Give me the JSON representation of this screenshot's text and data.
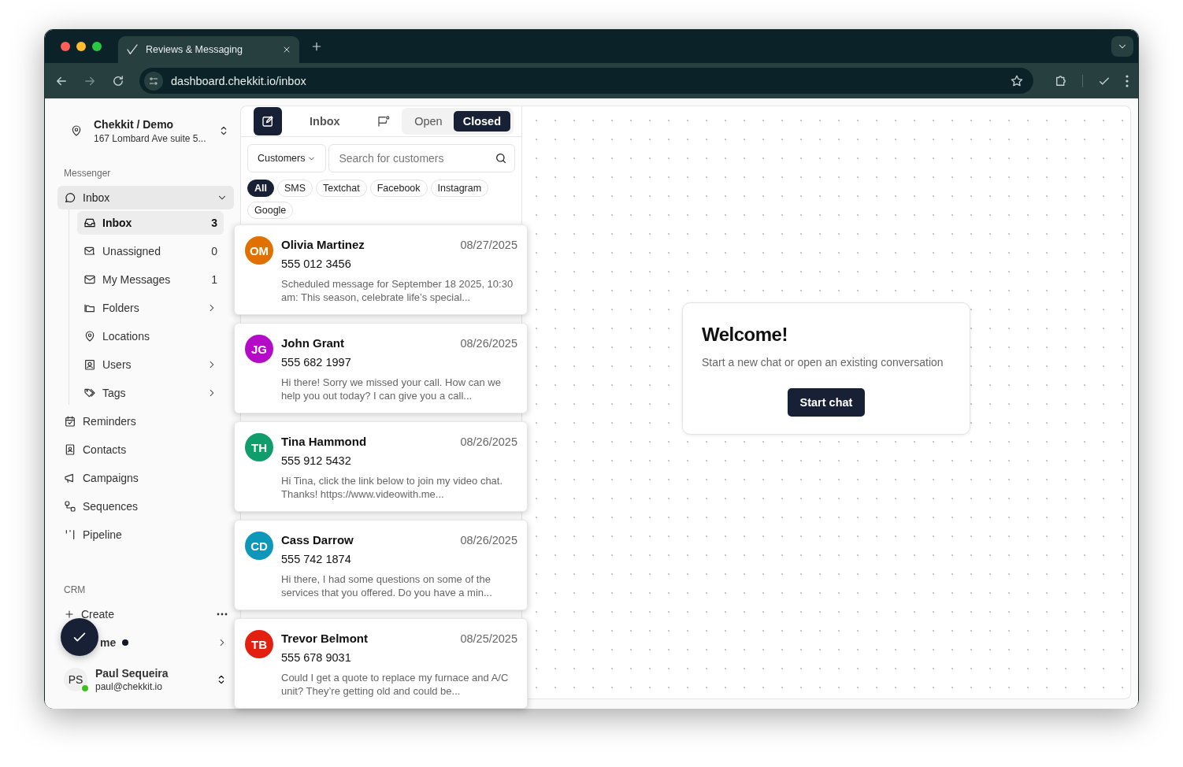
{
  "browser": {
    "tab_title": "Reviews & Messaging",
    "url": "dashboard.chekkit.io/inbox"
  },
  "account": {
    "name": "Chekkit / Demo",
    "address": "167 Lombard Ave suite 5..."
  },
  "sidebar": {
    "messenger_heading": "Messenger",
    "group": {
      "label": "Inbox",
      "selected": true,
      "expanded": true,
      "children": [
        {
          "label": "Inbox",
          "kind": "count",
          "count": "3",
          "selected": true
        },
        {
          "label": "Unassigned",
          "kind": "count",
          "count": "0",
          "selected": false
        },
        {
          "label": "My Messages",
          "kind": "count",
          "count": "1",
          "selected": false
        },
        {
          "label": "Folders",
          "kind": "submenu",
          "selected": false
        },
        {
          "label": "Locations",
          "kind": "plain",
          "selected": false
        },
        {
          "label": "Users",
          "kind": "submenu",
          "selected": false
        },
        {
          "label": "Tags",
          "kind": "submenu",
          "selected": false
        }
      ]
    },
    "items": [
      {
        "label": "Reminders"
      },
      {
        "label": "Contacts"
      },
      {
        "label": "Campaigns"
      },
      {
        "label": "Sequences"
      },
      {
        "label": "Pipeline"
      }
    ],
    "crm_heading": "CRM",
    "create": "Create",
    "home": {
      "label": "me",
      "unread": true
    },
    "user": {
      "initials": "PS",
      "name": "Paul Sequeira",
      "email": "paul@chekkit.io",
      "online": true
    }
  },
  "inbox": {
    "title": "Inbox",
    "status_tabs": [
      {
        "label": "Open",
        "selected": false
      },
      {
        "label": "Closed",
        "selected": true
      }
    ],
    "dropdown": "Customers",
    "search_placeholder": "Search for customers",
    "channels": [
      {
        "label": "All",
        "selected": true
      },
      {
        "label": "SMS",
        "selected": false
      },
      {
        "label": "Textchat",
        "selected": false
      },
      {
        "label": "Facebook",
        "selected": false
      },
      {
        "label": "Instagram",
        "selected": false
      },
      {
        "label": "Google",
        "selected": false
      }
    ],
    "conversations": [
      {
        "initials": "OM",
        "color": "#e07000",
        "name": "Olivia Martinez",
        "date": "08/27/2025",
        "phone": "555 012 3456",
        "preview": "Scheduled message for September 18 2025, 10:30 am: This season, celebrate life’s special..."
      },
      {
        "initials": "JG",
        "color": "#b60ac9",
        "name": "John Grant",
        "date": "08/26/2025",
        "phone": "555 682 1997",
        "preview": "Hi there! Sorry we missed your call. How can we help you out today? I can give you a call..."
      },
      {
        "initials": "TH",
        "color": "#0f9d6b",
        "name": "Tina Hammond",
        "date": "08/26/2025",
        "phone": "555 912 5432",
        "preview": "Hi Tina, click the link below to join my video chat. Thanks! https://www.videowith.me..."
      },
      {
        "initials": "CD",
        "color": "#0e97b9",
        "name": "Cass Darrow",
        "date": "08/26/2025",
        "phone": "555 742 1874",
        "preview": "Hi there, I had some questions on some of the services that you offered. Do you have a min..."
      },
      {
        "initials": "TB",
        "color": "#e3200f",
        "name": "Trevor Belmont",
        "date": "08/25/2025",
        "phone": "555 678 9031",
        "preview": "Could I get a quote to replace my furnace and A/C unit? They’re getting old and could be..."
      }
    ]
  },
  "welcome": {
    "title": "Welcome!",
    "text": "Start a new chat or open an existing conversation",
    "button": "Start chat"
  }
}
